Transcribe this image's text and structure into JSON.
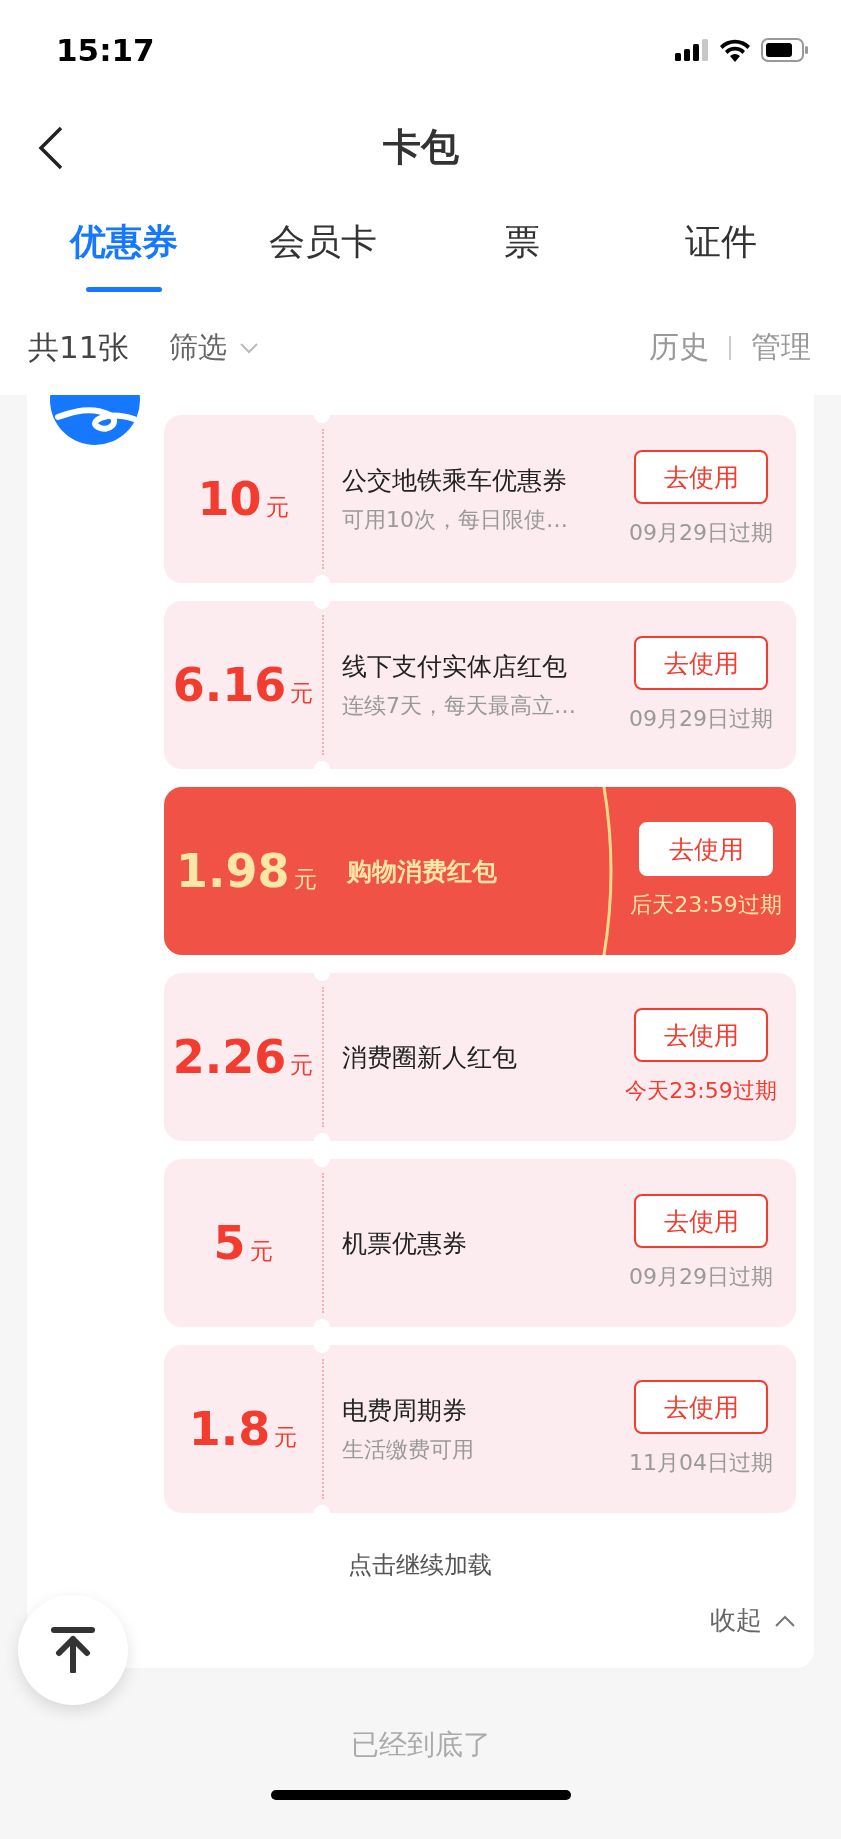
{
  "status_bar": {
    "time": "15:17"
  },
  "nav": {
    "title": "卡包"
  },
  "tabs": [
    {
      "label": "优惠券",
      "selected": true
    },
    {
      "label": "会员卡",
      "selected": false
    },
    {
      "label": "票",
      "selected": false
    },
    {
      "label": "证件",
      "selected": false
    }
  ],
  "filter_bar": {
    "count": "共11张",
    "filter": "筛选",
    "history": "历史",
    "manage": "管理"
  },
  "coupons": [
    {
      "amount": "10",
      "unit": "元",
      "title": "公交地铁乘车优惠券",
      "subtitle": "可用10次，每日限使…",
      "button": "去使用",
      "expiry": "09月29日过期",
      "highlighted": false,
      "expiry_urgent": false
    },
    {
      "amount": "6.16",
      "unit": "元",
      "title": "线下支付实体店红包",
      "subtitle": "连续7天，每天最高立…",
      "button": "去使用",
      "expiry": "09月29日过期",
      "highlighted": false,
      "expiry_urgent": false
    },
    {
      "amount": "1.98",
      "unit": "元",
      "title": "购物消费红包",
      "button": "去使用",
      "expiry": "后天23:59过期",
      "highlighted": true,
      "expiry_urgent": false
    },
    {
      "amount": "2.26",
      "unit": "元",
      "title": "消费圈新人红包",
      "button": "去使用",
      "expiry": "今天23:59过期",
      "highlighted": false,
      "expiry_urgent": true
    },
    {
      "amount": "5",
      "unit": "元",
      "title": "机票优惠券",
      "button": "去使用",
      "expiry": "09月29日过期",
      "highlighted": false,
      "expiry_urgent": false
    },
    {
      "amount": "1.8",
      "unit": "元",
      "title": "电费周期券",
      "subtitle": "生活缴费可用",
      "button": "去使用",
      "expiry": "11月04日过期",
      "highlighted": false,
      "expiry_urgent": false
    }
  ],
  "load_more": "点击继续加载",
  "collapse": "收起",
  "end_text": "已经到底了"
}
